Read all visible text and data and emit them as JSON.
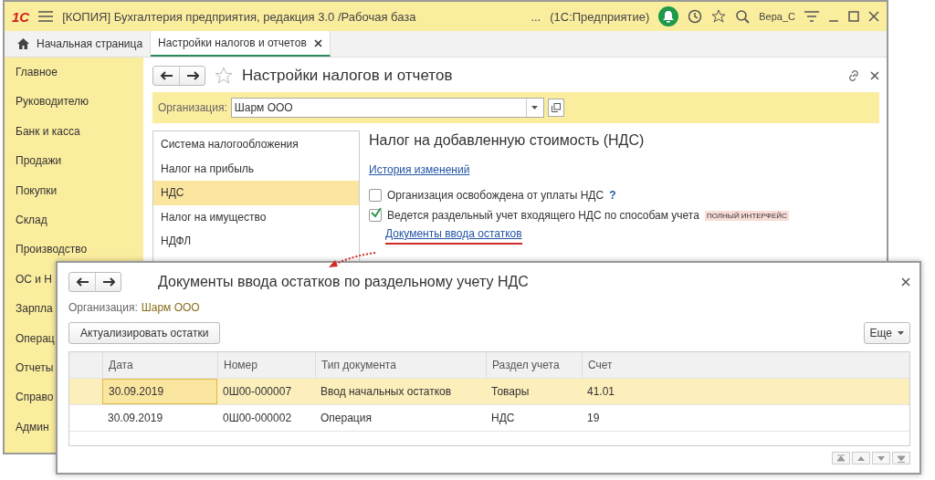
{
  "app": {
    "logo": "1С",
    "title": "[КОПИЯ] Бухгалтерия предприятия, редакция 3.0 /Рабочая база",
    "ellipsis": "...",
    "platform": "(1С:Предприятие)",
    "user": "Вера_С"
  },
  "tabs": [
    {
      "label": "Начальная страница",
      "selected": false,
      "kind": "home"
    },
    {
      "label": "Настройки налогов и отчетов",
      "selected": true,
      "kind": "closable"
    }
  ],
  "sidebar": {
    "items": [
      {
        "label": "Главное"
      },
      {
        "label": "Руководителю"
      },
      {
        "label": "Банк и касса"
      },
      {
        "label": "Продажи"
      },
      {
        "label": "Покупки"
      },
      {
        "label": "Склад"
      },
      {
        "label": "Производство"
      },
      {
        "label": "ОС и Н"
      },
      {
        "label": "Зарпла"
      },
      {
        "label": "Операц"
      },
      {
        "label": "Отчеты"
      },
      {
        "label": "Справо"
      },
      {
        "label": "Админ"
      }
    ]
  },
  "form": {
    "title": "Настройки налогов и отчетов",
    "org_label": "Организация:",
    "org_value": "Шарм ООО",
    "sections": [
      {
        "label": "Система налогообложения",
        "selected": false
      },
      {
        "label": "Налог на прибыль",
        "selected": false
      },
      {
        "label": "НДС",
        "selected": true
      },
      {
        "label": "Налог на имущество",
        "selected": false
      },
      {
        "label": "НДФЛ",
        "selected": false
      }
    ],
    "heading": "Налог на добавленную стоимость (НДС)",
    "history_link": "История изменений",
    "options": [
      {
        "label": "Организация освобождена от уплаты НДС",
        "checked": false,
        "help": "?"
      },
      {
        "label": "Ведется раздельный учет входящего НДС по способам учета",
        "checked": true,
        "badge": "ПОЛНЫЙ ИНТЕРФЕЙС"
      }
    ],
    "docs_link": "Документы ввода остатков"
  },
  "dialog": {
    "title": "Документы ввода остатков по раздельному учету НДС",
    "org_label": "Организация:",
    "org_value": "Шарм ООО",
    "action_button": "Актуализировать остатки",
    "more_button": "Еще",
    "table": {
      "columns": [
        "Дата",
        "Номер",
        "Тип документа",
        "Раздел учета",
        "Счет"
      ],
      "rows": [
        {
          "cells": [
            "30.09.2019",
            "0Ш00-000007",
            "Ввод начальных остатков",
            "Товары",
            "41.01"
          ],
          "selected": true
        },
        {
          "cells": [
            "30.09.2019",
            "0Ш00-000002",
            "Операция",
            "НДС",
            "19"
          ],
          "selected": false
        }
      ]
    }
  }
}
